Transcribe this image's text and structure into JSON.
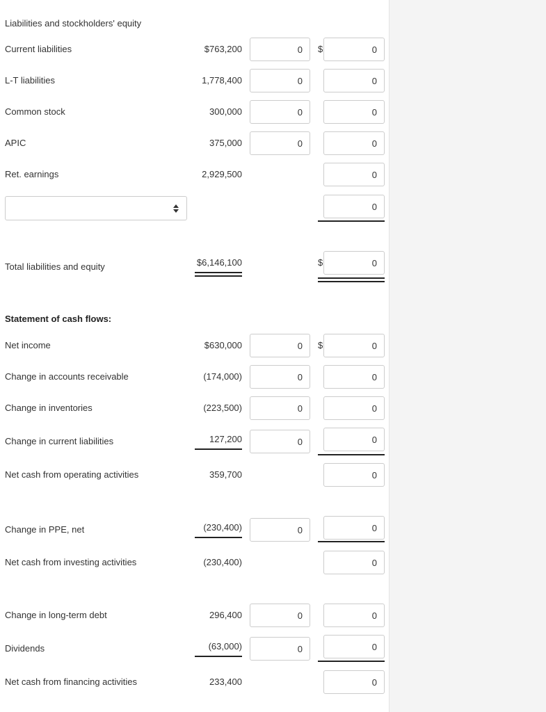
{
  "balance": {
    "section_title": "Liabilities and stockholders' equity",
    "dollar_sign": "$",
    "rows": [
      {
        "label": "Current liabilities",
        "amount": "$763,200",
        "input1": "0",
        "input2": "0"
      },
      {
        "label": "L-T liabilities",
        "amount": "1,778,400",
        "input1": "0",
        "input2": "0"
      },
      {
        "label": "Common stock",
        "amount": "300,000",
        "input1": "0",
        "input2": "0"
      },
      {
        "label": "APIC",
        "amount": "375,000",
        "input1": "0",
        "input2": "0"
      },
      {
        "label": "Ret. earnings",
        "amount": "2,929,500",
        "input2": "0"
      },
      {
        "input2": "0"
      }
    ],
    "select_value": "",
    "total": {
      "label": "Total liabilities and equity",
      "amount": "$6,146,100",
      "input2": "0"
    }
  },
  "cashflow": {
    "title": "Statement of cash flows:",
    "rows": [
      {
        "label": "Net income",
        "amount": "$630,000",
        "input1": "0",
        "input2": "0"
      },
      {
        "label": "Change in accounts receivable",
        "amount": "(174,000)",
        "input1": "0",
        "input2": "0"
      },
      {
        "label": "Change in inventories",
        "amount": "(223,500)",
        "input1": "0",
        "input2": "0"
      },
      {
        "label": "Change in current liabilities",
        "amount": "127,200",
        "input1": "0",
        "input2": "0"
      },
      {
        "label": "Net cash from operating activities",
        "amount": "359,700",
        "input2": "0"
      },
      {
        "label": "Change in PPE, net",
        "amount": "(230,400)",
        "input1": "0",
        "input2": "0"
      },
      {
        "label": "Net cash from investing activities",
        "amount": "(230,400)",
        "input2": "0"
      },
      {
        "label": "Change in long-term debt",
        "amount": "296,400",
        "input1": "0",
        "input2": "0"
      },
      {
        "label": "Dividends",
        "amount": "(63,000)",
        "input1": "0",
        "input2": "0"
      },
      {
        "label": "Net cash from financing activities",
        "amount": "233,400",
        "input2": "0"
      }
    ]
  }
}
